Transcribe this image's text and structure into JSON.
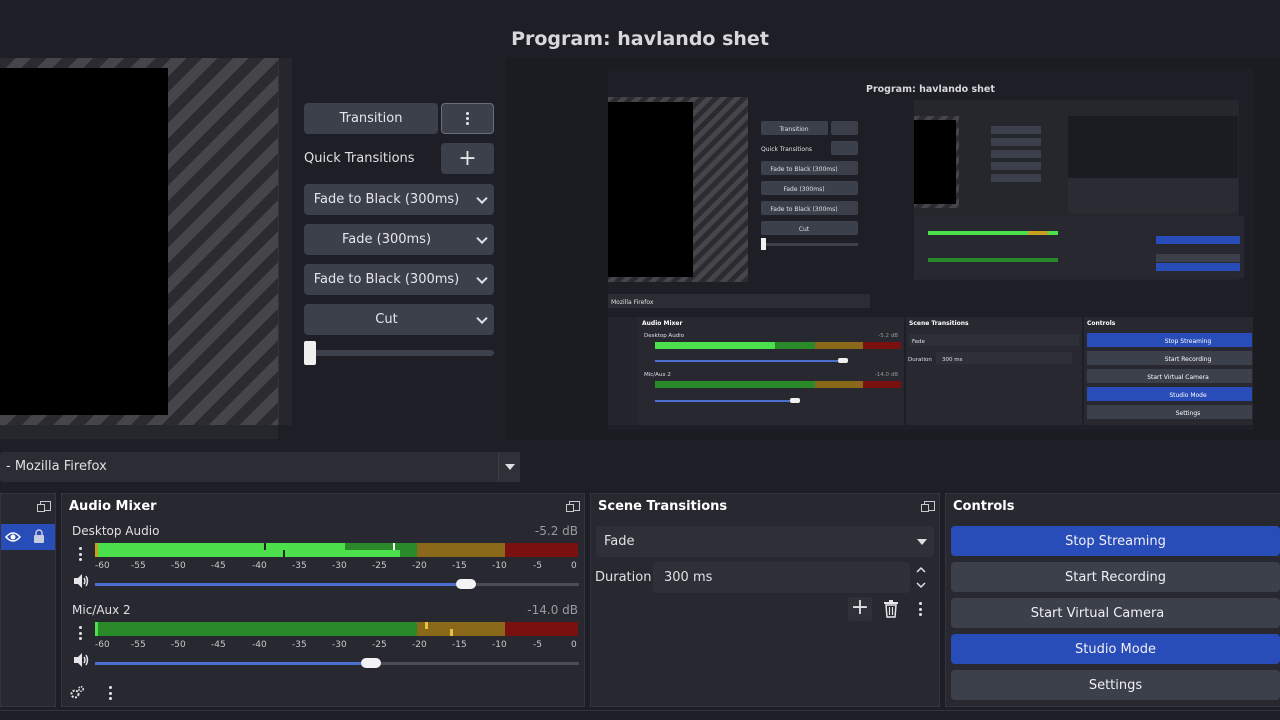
{
  "program": {
    "title": "Program: havlando shet"
  },
  "transitions_panel": {
    "transition_label": "Transition",
    "quick_transitions_label": "Quick Transitions",
    "items": [
      "Fade to Black (300ms)",
      "Fade (300ms)",
      "Fade to Black (300ms)",
      "Cut"
    ],
    "tbar_level": 0.0
  },
  "source_bar": {
    "selected": "- Mozilla Firefox"
  },
  "audio_mixer": {
    "title": "Audio Mixer",
    "channels": [
      {
        "name": "Desktop Audio",
        "db": "-5.2 dB",
        "volume": 0.77
      },
      {
        "name": "Mic/Aux 2",
        "db": "-14.0 dB",
        "volume": 0.57
      }
    ],
    "ticks": [
      "-60",
      "-55",
      "-50",
      "-45",
      "-40",
      "-35",
      "-30",
      "-25",
      "-20",
      "-15",
      "-10",
      "-5",
      "0"
    ]
  },
  "scene_transitions": {
    "title": "Scene Transitions",
    "selected": "Fade",
    "duration_label": "Duration",
    "duration_value": "300 ms"
  },
  "controls": {
    "title": "Controls",
    "stop_streaming": "Stop Streaming",
    "start_recording": "Start Recording",
    "start_virtual_camera": "Start Virtual Camera",
    "studio_mode": "Studio Mode",
    "settings": "Settings"
  },
  "nested_preview": {
    "title": "Program: havlando shet",
    "transition": "Transition",
    "quick_transitions": "Quick Transitions",
    "items": [
      "Fade to Black (300ms)",
      "Fade (300ms)",
      "Fade to Black (300ms)",
      "Cut"
    ],
    "source": "Mozilla Firefox",
    "audio_mixer": "Audio Mixer",
    "desktop_audio": "Desktop Audio",
    "desktop_db": "-5.2 dB",
    "mic": "Mic/Aux 2",
    "mic_db": "-14.0 dB",
    "scene_transitions": "Scene Transitions",
    "fade": "Fade",
    "duration": "Duration",
    "duration_value": "300 ms",
    "controls": "Controls",
    "stop_streaming": "Stop Streaming",
    "start_recording": "Start Recording",
    "start_virtual_camera": "Start Virtual Camera",
    "studio_mode": "Studio Mode",
    "settings": "Settings"
  },
  "colors": {
    "accent": "#284cb8",
    "meter_green": "#4ce04c",
    "meter_yellow": "#c8a020",
    "meter_red": "#c01818"
  }
}
